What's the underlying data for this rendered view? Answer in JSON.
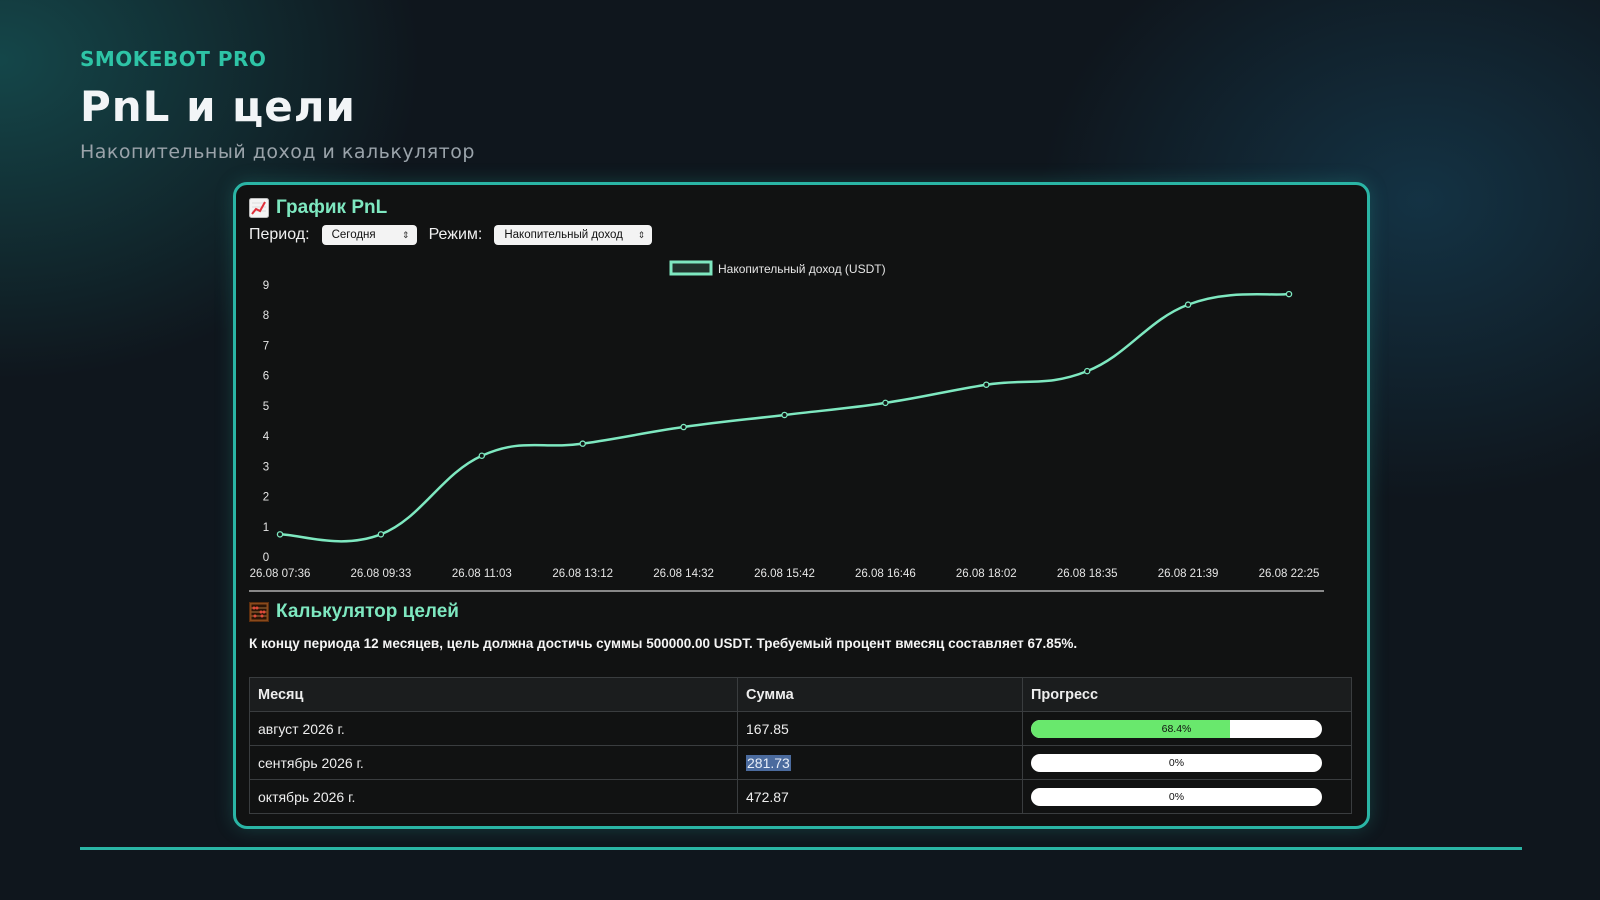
{
  "header": {
    "brand": "SMOKEBOT PRO",
    "title": "PnL и цели",
    "subtitle": "Накопительный доход и калькулятор"
  },
  "chart_section": {
    "title": "График PnL",
    "icon": "chart-icon",
    "period_label": "Период:",
    "period_value": "Сегодня",
    "mode_label": "Режим:",
    "mode_value": "Накопительный доход"
  },
  "chart_data": {
    "type": "line",
    "title": "",
    "xlabel": "",
    "ylabel": "",
    "series": [
      {
        "name": "Накопительный доход (USDT)",
        "values": [
          0.75,
          0.75,
          3.35,
          3.75,
          4.3,
          4.7,
          5.1,
          5.7,
          6.15,
          8.35,
          8.7
        ]
      }
    ],
    "categories": [
      "26.08 07:36",
      "26.08 09:33",
      "26.08 11:03",
      "26.08 13:12",
      "26.08 14:32",
      "26.08 15:42",
      "26.08 16:46",
      "26.08 18:02",
      "26.08 18:35",
      "26.08 21:39",
      "26.08 22:25"
    ],
    "ylim": [
      0,
      9
    ],
    "yticks": [
      0,
      1,
      2,
      3,
      4,
      5,
      6,
      7,
      8,
      9
    ],
    "legend": "top-center",
    "grid": false,
    "line_color": "#7ee8c0"
  },
  "calculator": {
    "title": "Калькулятор целей",
    "icon": "abacus-icon",
    "summary": "К концу периода 12 месяцев, цель должна достичь суммы 500000.00 USDT. Требуемый процент вмесяц составляет 67.85%.",
    "columns": [
      "Месяц",
      "Сумма",
      "Прогресс"
    ],
    "rows": [
      {
        "month": "август 2026 г.",
        "sum": "167.85",
        "progress_label": "68.4%",
        "progress": 0.684
      },
      {
        "month": "сентябрь 2026 г.",
        "sum": "281.73",
        "progress_label": "0%",
        "progress": 0
      },
      {
        "month": "октябрь 2026 г.",
        "sum": "472.87",
        "progress_label": "0%",
        "progress": 0
      }
    ]
  },
  "colors": {
    "accent": "#2ab5a5",
    "brand": "#2ec4a6",
    "progress_fill": "#69e86d"
  }
}
